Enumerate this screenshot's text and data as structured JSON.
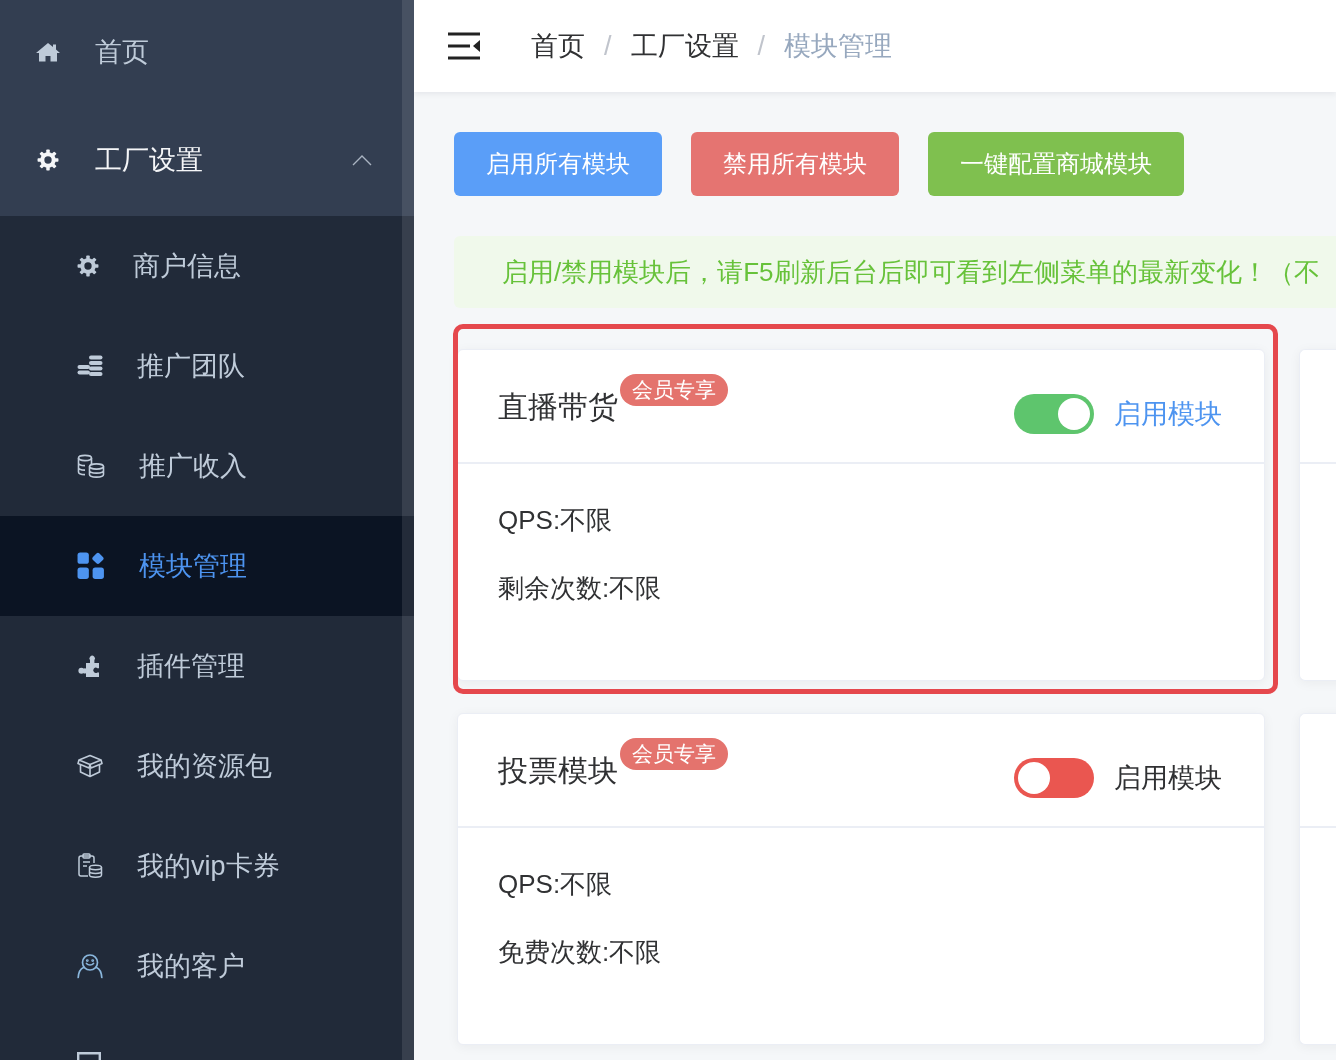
{
  "sidebar": {
    "items": [
      {
        "label": "首页",
        "selected": false
      },
      {
        "label": "工厂设置",
        "selected": false,
        "expanded": true,
        "children": [
          {
            "label": "商户信息",
            "selected": false
          },
          {
            "label": "推广团队",
            "selected": false
          },
          {
            "label": "推广收入",
            "selected": false
          },
          {
            "label": "模块管理",
            "selected": true
          },
          {
            "label": "插件管理",
            "selected": false
          },
          {
            "label": "我的资源包",
            "selected": false
          },
          {
            "label": "我的vip卡券",
            "selected": false
          },
          {
            "label": "我的客户",
            "selected": false
          },
          {
            "selected": false
          }
        ]
      }
    ]
  },
  "header": {
    "breadcrumb": [
      {
        "kind": "link",
        "label": "首页"
      },
      {
        "kind": "separator",
        "label": "/"
      },
      {
        "kind": "link",
        "label": "工厂设置"
      },
      {
        "kind": "separator",
        "label": "/"
      },
      {
        "kind": "current",
        "label": "模块管理"
      }
    ]
  },
  "toolbar": {
    "buttons": [
      {
        "kind": "primary",
        "label": "启用所有模块"
      },
      {
        "kind": "danger",
        "label": "禁用所有模块"
      },
      {
        "kind": "success",
        "label": "一键配置商城模块"
      }
    ]
  },
  "notice": {
    "kind": "success",
    "text": "启用/禁用模块后，请F5刷新后台后即可看到左侧菜单的最新变化！（不"
  },
  "modules": [
    {
      "kind": "card",
      "title": "直播带货",
      "badge": "会员专享",
      "enabled": true,
      "toggle_label": "启用模块",
      "highlighted": true,
      "details": [
        "QPS:不限",
        "剩余次数:不限"
      ]
    },
    {
      "kind": "clipped"
    },
    {
      "kind": "card",
      "title": "投票模块",
      "badge": "会员专享",
      "enabled": false,
      "toggle_label": "启用模块",
      "highlighted": false,
      "details": [
        "QPS:不限",
        "免费次数:不限"
      ]
    },
    {
      "kind": "clipped"
    }
  ]
}
